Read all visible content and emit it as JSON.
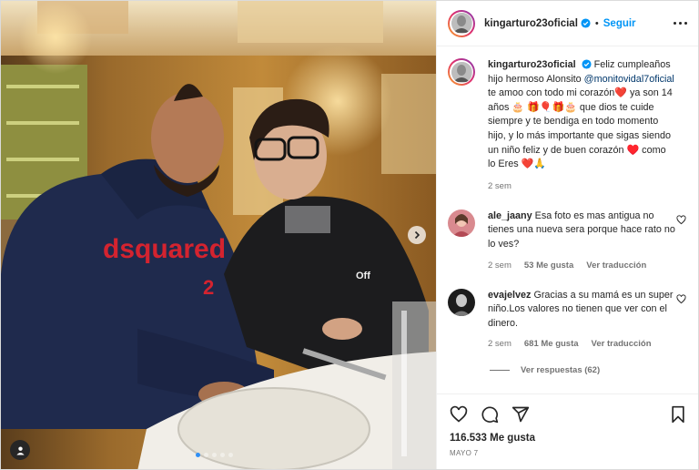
{
  "post": {
    "username": "kingarturo23oficial",
    "follow_label": "Seguir",
    "caption": {
      "username": "kingarturo23oficial",
      "text_1": "Feliz cumpleaños hijo hermoso Alonsito",
      "mention": "@monitovidal7oficial",
      "text_2": "te amoo con todo mi corazón",
      "emoji_1": "❤️",
      "text_3": "ya son 14 años",
      "emoji_2": "🎂",
      "emoji_3": "🎁🎈🎁🎂",
      "text_4": "que dios te cuide siempre y te bendiga en todo momento hijo, y lo más importante que sigas siendo un niño feliz y de buen corazón",
      "emoji_4": "♥️",
      "text_5": "como lo Eres",
      "emoji_5": "❤️🙏",
      "time": "2 sem"
    },
    "comments": [
      {
        "username": "ale_jaany",
        "text": "Esa foto es mas antigua no tienes una nueva sera porque hace rato no lo ves?",
        "time": "2 sem",
        "likes": "53 Me gusta",
        "translate": "Ver traducción"
      },
      {
        "username": "evajelvez",
        "text": "Gracias a su mamá es un super niño.Los valores no tienen que ver con el dinero.",
        "time": "2 sem",
        "likes": "681 Me gusta",
        "translate": "Ver traducción",
        "replies": "Ver respuestas (62)"
      }
    ],
    "likes_count": "116.533",
    "likes_label": "Me gusta",
    "date": "MAYO 7",
    "carousel": {
      "total": 5,
      "active": 1
    },
    "photo_text": {
      "hoodie_logo": "dsquared",
      "hoodie_sub": "2",
      "kid_logo": "Off"
    }
  },
  "colors": {
    "accent": "#0095f6",
    "verified": "#0095f6",
    "muted": "#737373",
    "hoodie_red": "#d4232f",
    "hoodie_navy": "#1f2a4d"
  },
  "icons": {
    "like": "heart-icon",
    "comment": "comment-icon",
    "share": "share-icon",
    "save": "bookmark-icon",
    "more": "more-icon",
    "next": "chevron-right-icon",
    "tag": "user-tag-icon"
  }
}
